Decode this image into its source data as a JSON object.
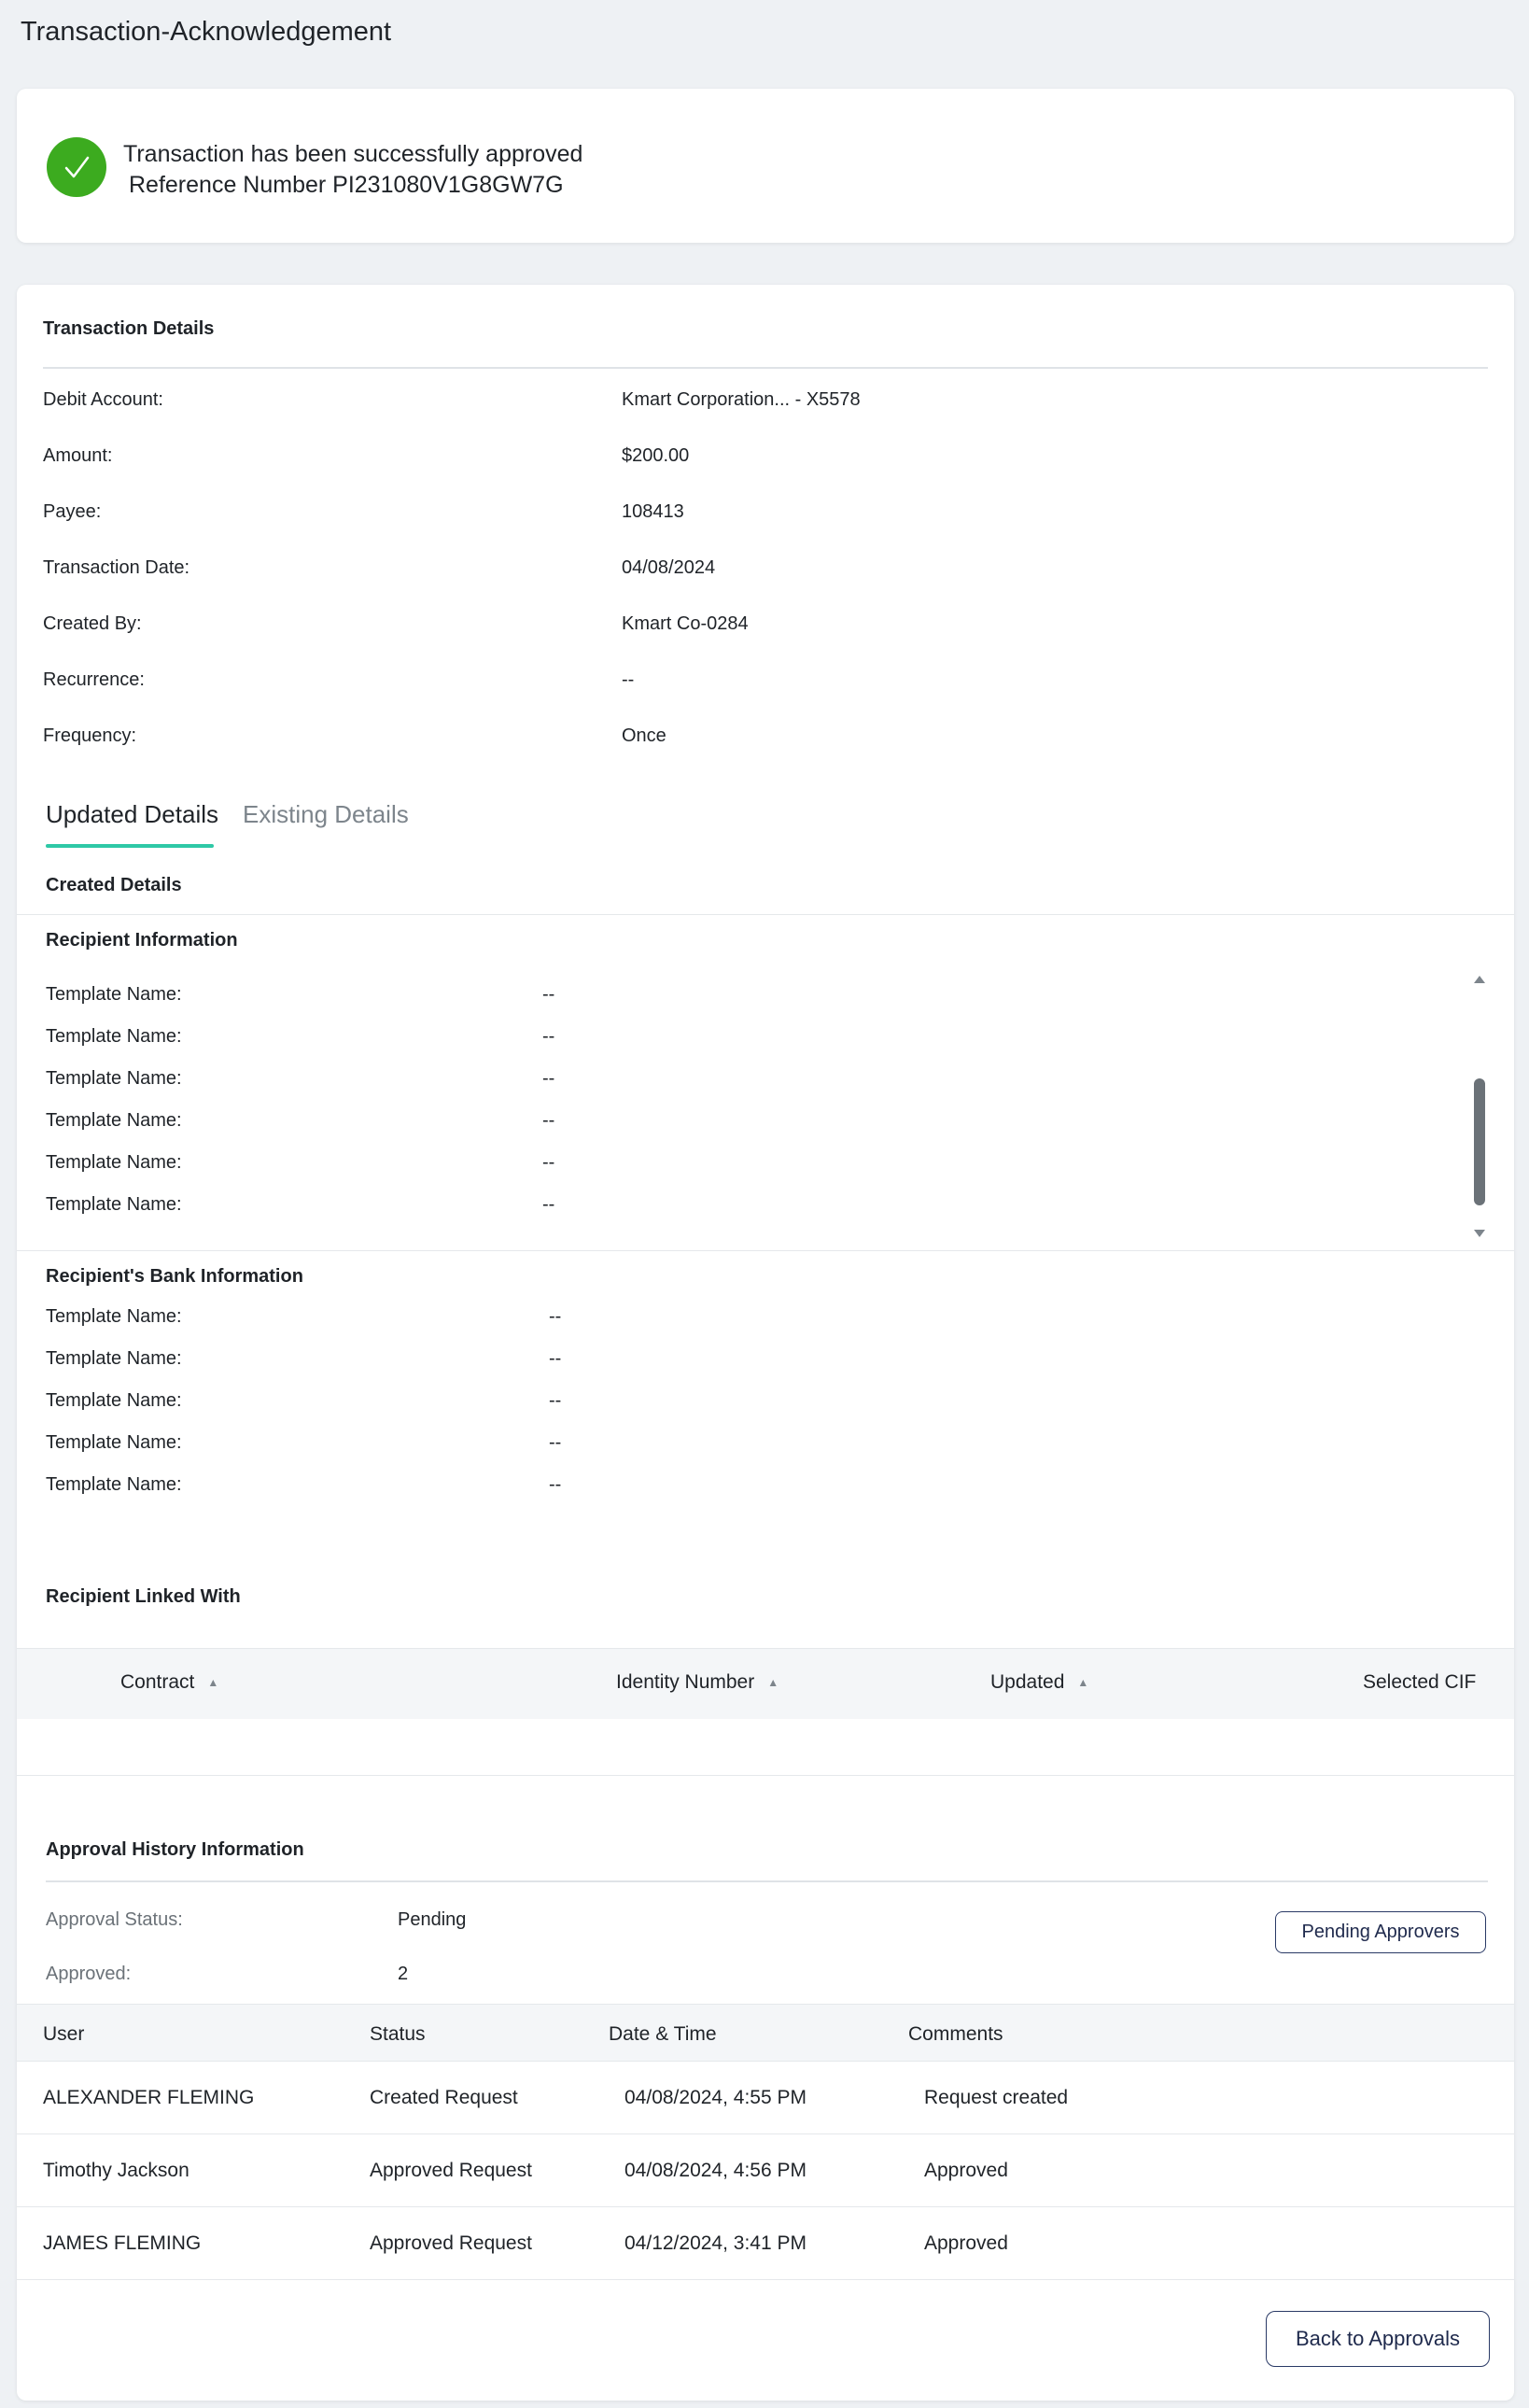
{
  "page": {
    "title": "Transaction-Acknowledgement"
  },
  "ack": {
    "message": "Transaction has been successfully approved",
    "reference": "Reference Number PI231080V1G8GW7G"
  },
  "transaction_details": {
    "title": "Transaction Details",
    "fields": [
      {
        "label": "Debit Account:",
        "value": "Kmart Corporation... - X5578"
      },
      {
        "label": "Amount:",
        "value": "$200.00"
      },
      {
        "label": "Payee:",
        "value": "108413"
      },
      {
        "label": "Transaction Date:",
        "value": "04/08/2024"
      },
      {
        "label": "Created By:",
        "value": "Kmart Co-0284"
      },
      {
        "label": "Recurrence:",
        "value": "--"
      },
      {
        "label": "Frequency:",
        "value": "Once"
      }
    ]
  },
  "tabs": [
    {
      "label": "Updated Details",
      "active": true
    },
    {
      "label": "Existing Details",
      "active": false
    }
  ],
  "created_details": {
    "title": "Created Details"
  },
  "recipient_info": {
    "title": "Recipient Information",
    "rows": [
      {
        "label": "Template Name:",
        "value": "--"
      },
      {
        "label": "Template Name:",
        "value": "--"
      },
      {
        "label": "Template Name:",
        "value": "--"
      },
      {
        "label": "Template Name:",
        "value": "--"
      },
      {
        "label": "Template Name:",
        "value": "--"
      },
      {
        "label": "Template Name:",
        "value": "--"
      }
    ]
  },
  "bank_info": {
    "title": "Recipient's Bank Information",
    "rows": [
      {
        "label": "Template Name:",
        "value": "--"
      },
      {
        "label": "Template Name:",
        "value": "--"
      },
      {
        "label": "Template Name:",
        "value": "--"
      },
      {
        "label": "Template Name:",
        "value": "--"
      },
      {
        "label": "Template Name:",
        "value": "--"
      }
    ]
  },
  "linked_with": {
    "title": "Recipient Linked With",
    "columns": [
      "Contract",
      "Identity Number",
      "Updated",
      "Selected CIF"
    ]
  },
  "approval_history": {
    "title": "Approval History Information",
    "status_label": "Approval Status:",
    "status_value": "Pending",
    "approved_label": "Approved:",
    "approved_value": "2",
    "pending_button": "Pending Approvers",
    "columns": [
      "User",
      "Status",
      "Date & Time",
      "Comments"
    ],
    "rows": [
      {
        "user": "ALEXANDER FLEMING",
        "status": "Created Request",
        "datetime": "04/08/2024, 4:55 PM",
        "comments": "Request created"
      },
      {
        "user": "Timothy Jackson",
        "status": "Approved Request",
        "datetime": "04/08/2024, 4:56 PM",
        "comments": "Approved"
      },
      {
        "user": "JAMES FLEMING",
        "status": "Approved Request",
        "datetime": "04/12/2024, 3:41 PM",
        "comments": "Approved"
      }
    ]
  },
  "footer": {
    "back_button": "Back to Approvals"
  },
  "colors": {
    "success": "#3cab1f",
    "tab_accent": "#2ec8a6",
    "button_border": "#2a3a66"
  }
}
